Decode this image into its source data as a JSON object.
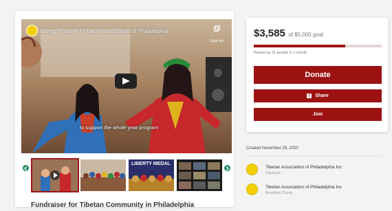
{
  "video": {
    "title": "Giving Tuesday | Tibetan Association of Philadelphia",
    "copy_link_label": "Copy link",
    "caption": "to support the whole year program",
    "thumbnail_count": 4,
    "active_thumbnail": 1
  },
  "thumbnails": [
    {
      "label": ""
    },
    {
      "label": ""
    },
    {
      "label": "LIBERTY MEDAL"
    },
    {
      "label": ""
    }
  ],
  "fundraiser": {
    "title": "Fundraiser for Tibetan Community in Philadelphia"
  },
  "donation": {
    "amount": "$3,585",
    "goal_text": "of $5,000 goal",
    "progress_fraction": 0.717,
    "raised_by": "Raised by 31 people in 1 month",
    "donate_label": "Donate",
    "share_label": "Share",
    "join_label": "Join"
  },
  "meta": {
    "created": "Created November 29, 2020"
  },
  "organizers": [
    {
      "name": "Tibetan Association of Philadelphia Inc",
      "role": "Organizer"
    },
    {
      "name": "Tibetan Association of Philadelphia Inc",
      "role": "Benefiting Charity"
    }
  ],
  "colors": {
    "accent": "#9c1212",
    "logo": "#f3d000",
    "arrow": "#1f8a5c"
  }
}
